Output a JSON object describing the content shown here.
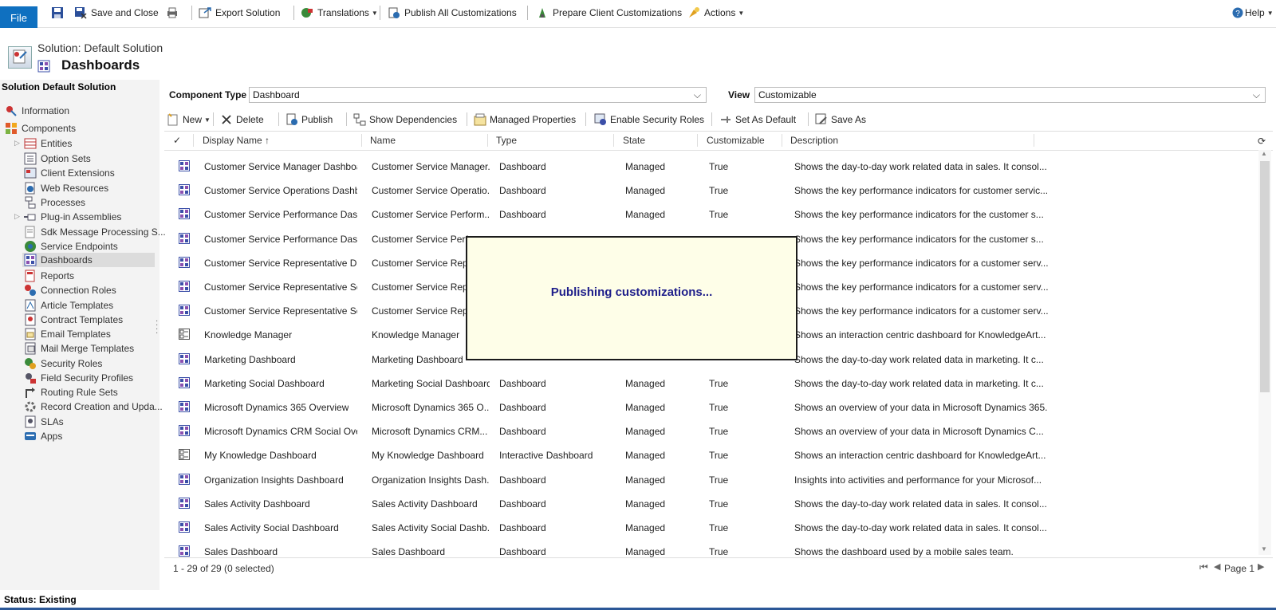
{
  "toolbar": {
    "file": "File",
    "save_close": "Save and Close",
    "export": "Export Solution",
    "translations": "Translations",
    "publish_all": "Publish All Customizations",
    "prepare_client": "Prepare Client Customizations",
    "actions": "Actions",
    "help": "Help"
  },
  "header": {
    "solution": "Solution: Default Solution",
    "title": "Dashboards"
  },
  "nav": {
    "title": "Solution Default Solution",
    "items": [
      {
        "label": "Information"
      },
      {
        "label": "Components"
      },
      {
        "label": "Entities"
      },
      {
        "label": "Option Sets"
      },
      {
        "label": "Client Extensions"
      },
      {
        "label": "Web Resources"
      },
      {
        "label": "Processes"
      },
      {
        "label": "Plug-in Assemblies"
      },
      {
        "label": "Sdk Message Processing S..."
      },
      {
        "label": "Service Endpoints"
      },
      {
        "label": "Dashboards"
      },
      {
        "label": "Reports"
      },
      {
        "label": "Connection Roles"
      },
      {
        "label": "Article Templates"
      },
      {
        "label": "Contract Templates"
      },
      {
        "label": "Email Templates"
      },
      {
        "label": "Mail Merge Templates"
      },
      {
        "label": "Security Roles"
      },
      {
        "label": "Field Security Profiles"
      },
      {
        "label": "Routing Rule Sets"
      },
      {
        "label": "Record Creation and Upda..."
      },
      {
        "label": "SLAs"
      },
      {
        "label": "Apps"
      }
    ]
  },
  "filter": {
    "component_type_label": "Component Type",
    "component_type_value": "Dashboard",
    "view_label": "View",
    "view_value": "Customizable"
  },
  "grid_toolbar": {
    "new": "New",
    "delete": "Delete",
    "publish": "Publish",
    "show_deps": "Show Dependencies",
    "managed_props": "Managed Properties",
    "enable_security": "Enable Security Roles",
    "set_default": "Set As Default",
    "save_as": "Save As"
  },
  "grid": {
    "columns": {
      "display_name": "Display Name ↑",
      "name": "Name",
      "type": "Type",
      "state": "State",
      "customizable": "Customizable",
      "description": "Description"
    },
    "rows": [
      {
        "display": "Customer Service Manager Dashboard",
        "name": "Customer Service Manager...",
        "type": "Dashboard",
        "state": "Managed",
        "custom": "True",
        "desc": "Shows the day-to-day work related data in sales. It consol..."
      },
      {
        "display": "Customer Service Operations Dashbo...",
        "name": "Customer Service Operatio...",
        "type": "Dashboard",
        "state": "Managed",
        "custom": "True",
        "desc": "Shows the key performance indicators for customer servic..."
      },
      {
        "display": "Customer Service Performance Dash...",
        "name": "Customer Service Perform...",
        "type": "Dashboard",
        "state": "Managed",
        "custom": "True",
        "desc": "Shows the key performance indicators for the customer s..."
      },
      {
        "display": "Customer Service Performance Dash...",
        "name": "Customer Service Perfo",
        "type": "",
        "state": "",
        "custom": "",
        "desc": "Shows the key performance indicators for the customer s..."
      },
      {
        "display": "Customer Service Representative Das...",
        "name": "Customer Service Repre",
        "type": "",
        "state": "",
        "custom": "",
        "desc": "Shows the key performance indicators for a customer serv..."
      },
      {
        "display": "Customer Service Representative Soc...",
        "name": "Customer Service Repre",
        "type": "",
        "state": "",
        "custom": "",
        "desc": "Shows the key performance indicators for a customer serv..."
      },
      {
        "display": "Customer Service Representative Soc...",
        "name": "Customer Service Repre",
        "type": "",
        "state": "",
        "custom": "",
        "desc": "Shows the key performance indicators for a customer serv..."
      },
      {
        "display": "Knowledge Manager",
        "name": "Knowledge Manager",
        "type": "",
        "state": "",
        "custom": "",
        "desc": "Shows an interaction centric dashboard for KnowledgeArt..."
      },
      {
        "display": "Marketing Dashboard",
        "name": "Marketing Dashboard",
        "type": "",
        "state": "",
        "custom": "",
        "desc": "Shows the day-to-day work related data in marketing. It c..."
      },
      {
        "display": "Marketing Social Dashboard",
        "name": "Marketing Social Dashboard",
        "type": "Dashboard",
        "state": "Managed",
        "custom": "True",
        "desc": "Shows the day-to-day work related data in marketing. It c..."
      },
      {
        "display": "Microsoft Dynamics 365 Overview",
        "name": "Microsoft Dynamics 365 O...",
        "type": "Dashboard",
        "state": "Managed",
        "custom": "True",
        "desc": "Shows an overview of your data in Microsoft Dynamics 365."
      },
      {
        "display": "Microsoft Dynamics CRM Social Over...",
        "name": "Microsoft Dynamics CRM...",
        "type": "Dashboard",
        "state": "Managed",
        "custom": "True",
        "desc": "Shows an overview of your data in Microsoft Dynamics C..."
      },
      {
        "display": "My Knowledge Dashboard",
        "name": "My Knowledge Dashboard",
        "type": "Interactive Dashboard",
        "state": "Managed",
        "custom": "True",
        "desc": "Shows an interaction centric dashboard for KnowledgeArt..."
      },
      {
        "display": "Organization Insights Dashboard",
        "name": "Organization Insights Dash...",
        "type": "Dashboard",
        "state": "Managed",
        "custom": "True",
        "desc": "Insights into activities and performance for your Microsof..."
      },
      {
        "display": "Sales Activity Dashboard",
        "name": "Sales Activity Dashboard",
        "type": "Dashboard",
        "state": "Managed",
        "custom": "True",
        "desc": "Shows the day-to-day work related data in sales. It consol..."
      },
      {
        "display": "Sales Activity Social Dashboard",
        "name": "Sales Activity Social Dashb...",
        "type": "Dashboard",
        "state": "Managed",
        "custom": "True",
        "desc": "Shows the day-to-day work related data in sales. It consol..."
      },
      {
        "display": "Sales Dashboard",
        "name": "Sales Dashboard",
        "type": "Dashboard",
        "state": "Managed",
        "custom": "True",
        "desc": "Shows the dashboard used by a mobile sales team."
      }
    ]
  },
  "footer": {
    "count": "1 - 29 of 29 (0 selected)",
    "page": "Page 1",
    "status": "Status: Existing"
  },
  "overlay": {
    "text": "Publishing customizations..."
  }
}
